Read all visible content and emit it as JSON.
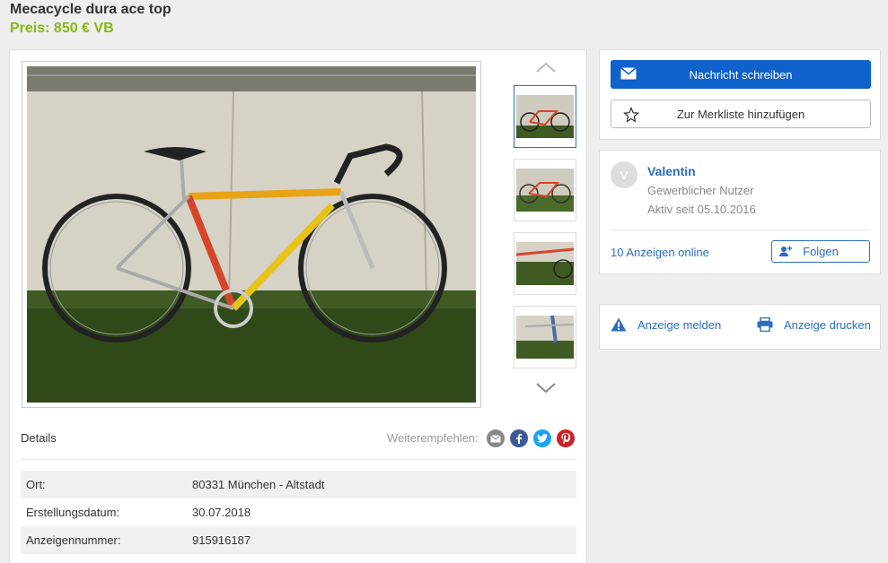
{
  "listing": {
    "title": "Mecacycle dura ace top",
    "price": "Preis: 850 € VB"
  },
  "gallery": {
    "thumbnails": [
      "bike-photo-1",
      "bike-photo-2",
      "bike-photo-3",
      "bike-photo-4"
    ],
    "active_index": 0
  },
  "details": {
    "label": "Details",
    "share_label": "Weiterempfehlen:",
    "share_icons": [
      "email-icon",
      "facebook-icon",
      "twitter-icon",
      "pinterest-icon"
    ],
    "rows": [
      {
        "key": "Ort:",
        "value": "80331 München - Altstadt"
      },
      {
        "key": "Erstellungsdatum:",
        "value": "30.07.2018"
      },
      {
        "key": "Anzeigennummer:",
        "value": "915916187"
      }
    ]
  },
  "actions": {
    "message_button": "Nachricht schreiben",
    "watchlist_button": "Zur Merkliste hinzufügen"
  },
  "seller": {
    "initial": "V",
    "name": "Valentin",
    "type": "Gewerblicher Nutzer",
    "active_since": "Aktiv seit 05.10.2016",
    "ads_online": "10 Anzeigen online",
    "follow_button": "Folgen"
  },
  "misc": {
    "report": "Anzeige melden",
    "print": "Anzeige drucken"
  },
  "colors": {
    "price": "#86b817",
    "primary": "#0f62cc",
    "link": "#2c6ebf"
  }
}
